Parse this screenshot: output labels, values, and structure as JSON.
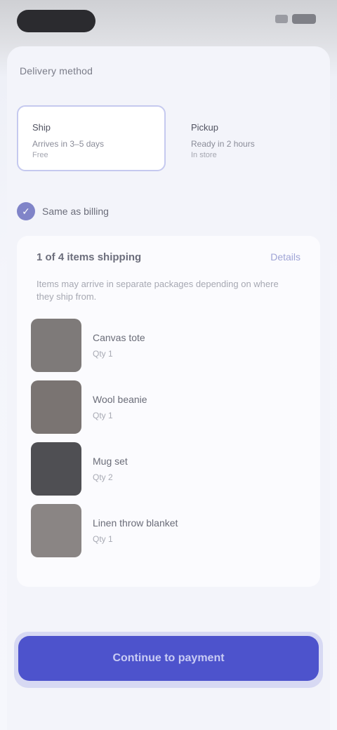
{
  "section": {
    "label": "Delivery method"
  },
  "options": [
    {
      "title": "Ship",
      "subtitle": "Arrives in 3–5 days",
      "note": "Free",
      "selected": true
    },
    {
      "title": "Pickup",
      "subtitle": "Ready in 2 hours",
      "note": "In store",
      "selected": false
    }
  ],
  "toggle": {
    "label": "Same as billing",
    "checked": true
  },
  "panel": {
    "heading": "1 of 4 items shipping",
    "link": "Details",
    "description": "Items may arrive in separate packages depending on where they ship from."
  },
  "items": [
    {
      "name": "Canvas tote",
      "meta": "Qty 1"
    },
    {
      "name": "Wool beanie",
      "meta": "Qty 1"
    },
    {
      "name": "Mug set",
      "meta": "Qty 2"
    },
    {
      "name": "Linen throw blanket",
      "meta": "Qty 1"
    }
  ],
  "cta": {
    "label": "Continue to payment"
  },
  "colors": {
    "accent": "#4d53cc",
    "selected_border": "#c5c9ef",
    "thumbs": [
      "#7e7a79",
      "#7a7472",
      "#4f4f53",
      "#8a8584"
    ]
  }
}
